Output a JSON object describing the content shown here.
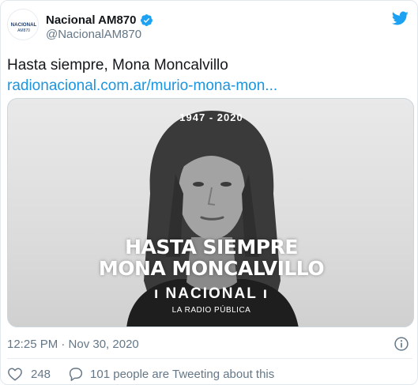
{
  "author": {
    "display_name": "Nacional AM870",
    "handle": "@NacionalAM870",
    "avatar_text": "NACIONAL",
    "avatar_sub": "AM870"
  },
  "tweet": {
    "text": "Hasta siempre, Mona Moncalvillo",
    "link": "radionacional.com.ar/murio-mona-mon..."
  },
  "media": {
    "years": "1947 - 2020",
    "headline_line1": "HASTA SIEMPRE",
    "headline_line2": "MONA MONCALVILLO",
    "logo": "ı NACIONAL ı",
    "logo_sub": "LA RADIO PÚBLICA"
  },
  "meta": {
    "timestamp": "12:25 PM · Nov 30, 2020"
  },
  "actions": {
    "like_count": "248",
    "reply_text": "101 people are Tweeting about this"
  },
  "colors": {
    "link": "#1b95e0",
    "twitter_blue": "#1da1f2",
    "heart": "#e0245e"
  },
  "icons": [
    "verified-badge-icon",
    "twitter-bird-icon",
    "info-icon",
    "heart-icon",
    "speech-bubble-icon"
  ]
}
